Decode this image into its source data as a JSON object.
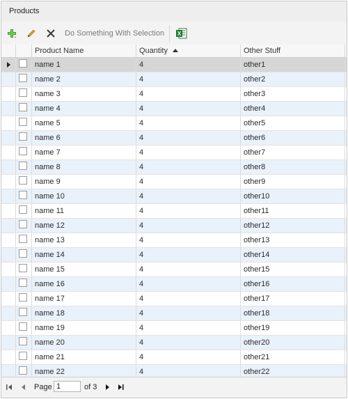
{
  "panel": {
    "title": "Products"
  },
  "toolbar": {
    "add_icon": "plus-icon",
    "edit_icon": "pencil-icon",
    "delete_icon": "x-icon",
    "action_label": "Do Something With Selection",
    "export_icon": "excel-icon"
  },
  "grid": {
    "columns": [
      {
        "label": "Product Name"
      },
      {
        "label": "Quantity",
        "sort": "ascending"
      },
      {
        "label": "Other Stuff"
      }
    ],
    "rows": [
      {
        "name": "name 1",
        "qty": "4",
        "other": "other1"
      },
      {
        "name": "name 2",
        "qty": "4",
        "other": "other2"
      },
      {
        "name": "name 3",
        "qty": "4",
        "other": "other3"
      },
      {
        "name": "name 4",
        "qty": "4",
        "other": "other4"
      },
      {
        "name": "name 5",
        "qty": "4",
        "other": "other5"
      },
      {
        "name": "name 6",
        "qty": "4",
        "other": "other6"
      },
      {
        "name": "name 7",
        "qty": "4",
        "other": "other7"
      },
      {
        "name": "name 8",
        "qty": "4",
        "other": "other8"
      },
      {
        "name": "name 9",
        "qty": "4",
        "other": "other9"
      },
      {
        "name": "name 10",
        "qty": "4",
        "other": "other10"
      },
      {
        "name": "name 11",
        "qty": "4",
        "other": "other11"
      },
      {
        "name": "name 12",
        "qty": "4",
        "other": "other12"
      },
      {
        "name": "name 13",
        "qty": "4",
        "other": "other13"
      },
      {
        "name": "name 14",
        "qty": "4",
        "other": "other14"
      },
      {
        "name": "name 15",
        "qty": "4",
        "other": "other15"
      },
      {
        "name": "name 16",
        "qty": "4",
        "other": "other16"
      },
      {
        "name": "name 17",
        "qty": "4",
        "other": "other17"
      },
      {
        "name": "name 18",
        "qty": "4",
        "other": "other18"
      },
      {
        "name": "name 19",
        "qty": "4",
        "other": "other19"
      },
      {
        "name": "name 20",
        "qty": "4",
        "other": "other20"
      },
      {
        "name": "name 21",
        "qty": "4",
        "other": "other21"
      },
      {
        "name": "name 22",
        "qty": "4",
        "other": "other22"
      }
    ]
  },
  "pager": {
    "page_label": "Page",
    "page_value": "1",
    "of_label": "of 3"
  }
}
